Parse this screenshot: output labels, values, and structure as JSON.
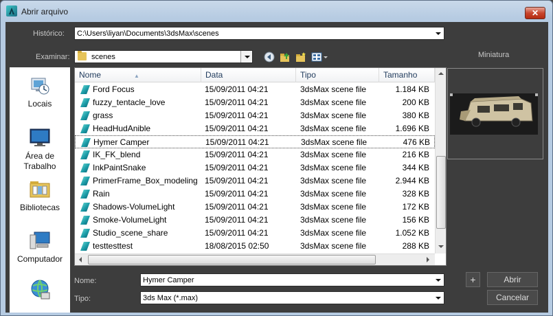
{
  "window": {
    "title": "Abrir arquivo",
    "close_label": "✕"
  },
  "historico": {
    "label": "Histórico:",
    "value": "C:\\Users\\liyan\\Documents\\3dsMax\\scenes"
  },
  "examinar": {
    "label": "Examinar:",
    "value": "scenes"
  },
  "toolbar": {
    "icons": [
      "back-icon",
      "up-folder-icon",
      "new-folder-icon",
      "view-menu-icon"
    ]
  },
  "miniatura_label": "Miniatura",
  "places": [
    {
      "label": "Locais",
      "icon": "recent-places-icon"
    },
    {
      "label": "Área de\nTrabalho",
      "icon": "desktop-icon"
    },
    {
      "label": "Bibliotecas",
      "icon": "libraries-icon"
    },
    {
      "label": "Computador",
      "icon": "computer-icon"
    },
    {
      "label": "",
      "icon": "network-icon"
    }
  ],
  "columns": [
    "Nome",
    "Data",
    "Tipo",
    "Tamanho"
  ],
  "files": [
    {
      "name": "Ford Focus",
      "date": "15/09/2011 04:21",
      "type": "3dsMax scene file",
      "size": "1.184 KB"
    },
    {
      "name": "fuzzy_tentacle_love",
      "date": "15/09/2011 04:21",
      "type": "3dsMax scene file",
      "size": "200 KB"
    },
    {
      "name": "grass",
      "date": "15/09/2011 04:21",
      "type": "3dsMax scene file",
      "size": "380 KB"
    },
    {
      "name": "HeadHudAnible",
      "date": "15/09/2011 04:21",
      "type": "3dsMax scene file",
      "size": "1.696 KB"
    },
    {
      "name": "Hymer Camper",
      "date": "15/09/2011 04:21",
      "type": "3dsMax scene file",
      "size": "476 KB",
      "selected": true
    },
    {
      "name": "IK_FK_blend",
      "date": "15/09/2011 04:21",
      "type": "3dsMax scene file",
      "size": "216 KB"
    },
    {
      "name": "InkPaintSnake",
      "date": "15/09/2011 04:21",
      "type": "3dsMax scene file",
      "size": "344 KB"
    },
    {
      "name": "PrimerFrame_Box_modeling",
      "date": "15/09/2011 04:21",
      "type": "3dsMax scene file",
      "size": "2.944 KB"
    },
    {
      "name": "Rain",
      "date": "15/09/2011 04:21",
      "type": "3dsMax scene file",
      "size": "328 KB"
    },
    {
      "name": "Shadows-VolumeLight",
      "date": "15/09/2011 04:21",
      "type": "3dsMax scene file",
      "size": "172 KB"
    },
    {
      "name": "Smoke-VolumeLight",
      "date": "15/09/2011 04:21",
      "type": "3dsMax scene file",
      "size": "156 KB"
    },
    {
      "name": "Studio_scene_share",
      "date": "15/09/2011 04:21",
      "type": "3dsMax scene file",
      "size": "1.052 KB"
    },
    {
      "name": "testtesttest",
      "date": "18/08/2015 02:50",
      "type": "3dsMax scene file",
      "size": "288 KB"
    }
  ],
  "nome": {
    "label": "Nome:",
    "value": "Hymer Camper"
  },
  "tipo": {
    "label": "Tipo:",
    "value": "3ds Max (*.max)"
  },
  "buttons": {
    "plus": "+",
    "abrir": "Abrir",
    "cancelar": "Cancelar"
  },
  "colors": {
    "client_bg": "#3d3d3d",
    "title_bg": "#c4d6ea",
    "close_red": "#c8462e"
  }
}
